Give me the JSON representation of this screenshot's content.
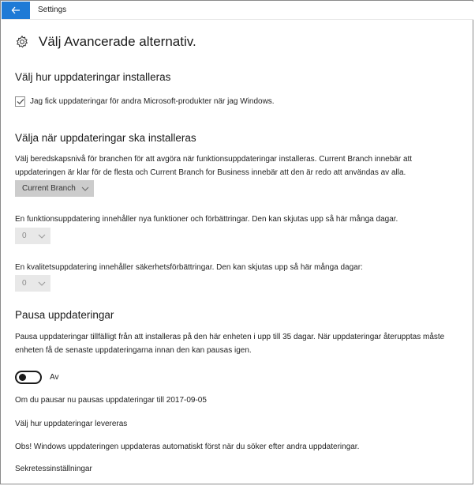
{
  "window": {
    "title": "Settings",
    "back_icon": "back-arrow-icon",
    "accent": "#1e7ad6"
  },
  "header": {
    "icon": "gear-icon",
    "title": "Välj Avancerade alternativ."
  },
  "install_section": {
    "heading": "Välj hur uppdateringar installeras",
    "checkbox_label": "Jag fick uppdateringar för andra Microsoft-produkter när jag Windows.",
    "checkbox_checked": true
  },
  "when_section": {
    "heading": "Välja när uppdateringar ska installeras",
    "description_line1": "Välj beredskapsnivå för branchen för att avgöra när funktionsuppdateringar installeras. Current Branch innebär att",
    "description_line2": "uppdateringen är klar för de flesta och Current Branch for Business innebär att den är redo att användas av alla.",
    "branch_value": "Current Branch",
    "feature_text": "En funktionsuppdatering innehåller nya funktioner och förbättringar. Den kan skjutas upp så här många dagar.",
    "feature_value": "0",
    "quality_text": "En kvalitetsuppdatering innehåller säkerhetsförbättringar. Den kan skjutas upp så här många dagar:",
    "quality_value": "0"
  },
  "pause_section": {
    "heading": "Pausa uppdateringar",
    "description_line1": "Pausa uppdateringar tillfälligt från att installeras på den här enheten i upp till 35 dagar. När uppdateringar återupptas måste",
    "description_line2": "enheten få de senaste uppdateringarna innan den kan pausas igen.",
    "toggle_label": "Av",
    "toggle_on": false,
    "pause_until": "Om du pausar nu pausas uppdateringar till 2017-09-05"
  },
  "links": {
    "delivery": "Välj hur uppdateringar levereras",
    "note": "Obs! Windows uppdateringen uppdateras automatiskt först när du söker efter andra uppdateringar.",
    "privacy": "Sekretessinställningar"
  }
}
